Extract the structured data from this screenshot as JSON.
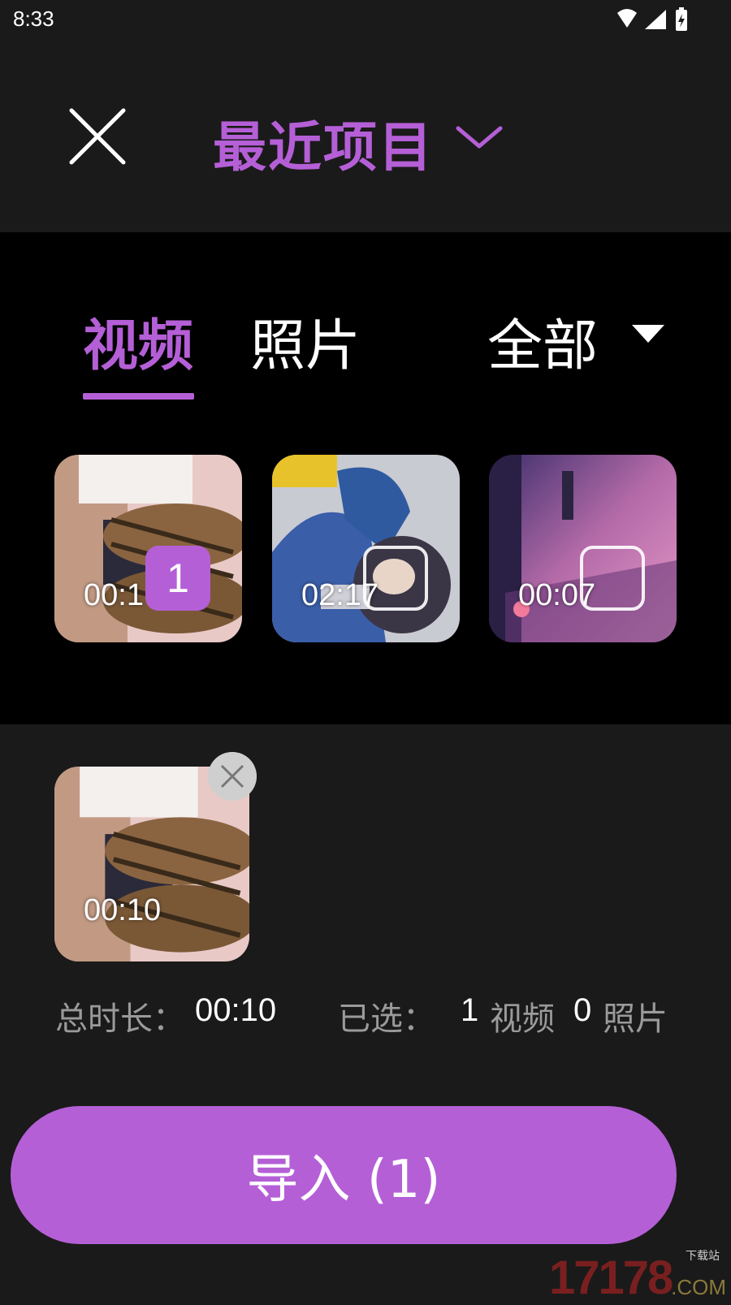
{
  "status_bar": {
    "time": "8:33"
  },
  "header": {
    "title": "最近项目"
  },
  "tabs": [
    {
      "label": "视频",
      "active": true
    },
    {
      "label": "照片",
      "active": false
    }
  ],
  "filter": {
    "label": "全部"
  },
  "media": [
    {
      "duration": "00:1",
      "selected": true,
      "select_index": "1"
    },
    {
      "duration": "02:17",
      "selected": false,
      "select_index": ""
    },
    {
      "duration": "00:07",
      "selected": false,
      "select_index": ""
    }
  ],
  "tray": [
    {
      "duration": "00:10"
    }
  ],
  "summary": {
    "total_label": "总时长：",
    "total_value": "00:10",
    "selected_label": "已选：",
    "video_count": "1",
    "video_word": "视频",
    "photo_count": "0",
    "photo_word": "照片"
  },
  "import_button": {
    "label": "导入 (1)"
  },
  "watermark": {
    "number": "17178",
    "sub": "下载站",
    "com": ".COM"
  },
  "colors": {
    "accent": "#b55fd7",
    "background": "#1a1a1a",
    "panel": "#000000"
  }
}
